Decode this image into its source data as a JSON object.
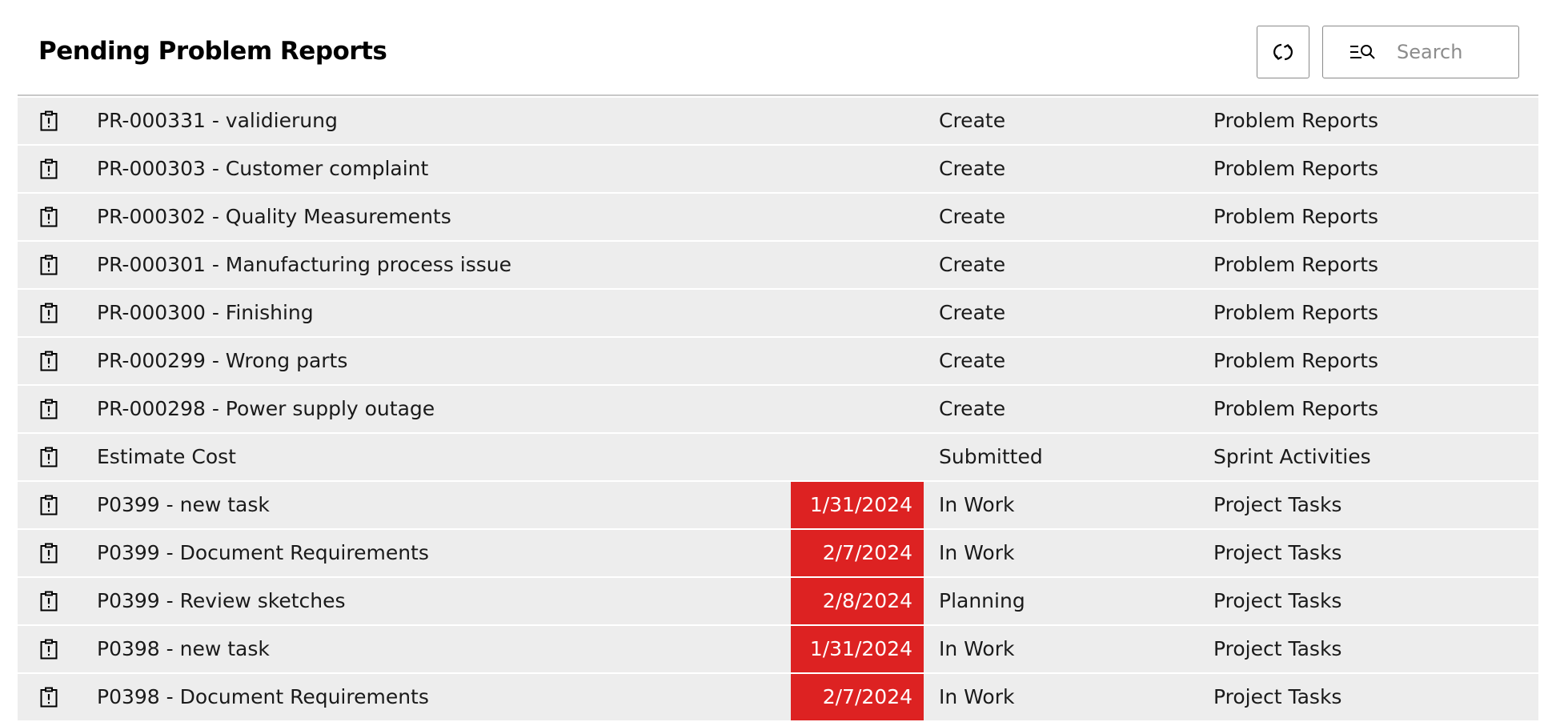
{
  "header": {
    "title": "Pending Problem Reports",
    "refresh_icon": "refresh-icon",
    "search": {
      "icon": "search-filter-icon",
      "placeholder": "Search",
      "value": ""
    }
  },
  "colors": {
    "row_background": "#ededed",
    "overdue": "#dd2222",
    "header_border": "#c8c8c8"
  },
  "rows": [
    {
      "icon": "clipboard-alert-icon",
      "title": "PR-000331 - validierung",
      "due_date": "",
      "status": "Create",
      "workspace": "Problem Reports"
    },
    {
      "icon": "clipboard-alert-icon",
      "title": "PR-000303 - Customer complaint",
      "due_date": "",
      "status": "Create",
      "workspace": "Problem Reports"
    },
    {
      "icon": "clipboard-alert-icon",
      "title": "PR-000302 - Quality Measurements",
      "due_date": "",
      "status": "Create",
      "workspace": "Problem Reports"
    },
    {
      "icon": "clipboard-alert-icon",
      "title": "PR-000301 - Manufacturing process issue",
      "due_date": "",
      "status": "Create",
      "workspace": "Problem Reports"
    },
    {
      "icon": "clipboard-alert-icon",
      "title": "PR-000300 - Finishing",
      "due_date": "",
      "status": "Create",
      "workspace": "Problem Reports"
    },
    {
      "icon": "clipboard-alert-icon",
      "title": "PR-000299 - Wrong parts",
      "due_date": "",
      "status": "Create",
      "workspace": "Problem Reports"
    },
    {
      "icon": "clipboard-alert-icon",
      "title": "PR-000298 - Power supply outage",
      "due_date": "",
      "status": "Create",
      "workspace": "Problem Reports"
    },
    {
      "icon": "clipboard-alert-icon",
      "title": "Estimate Cost",
      "due_date": "",
      "status": "Submitted",
      "workspace": "Sprint Activities"
    },
    {
      "icon": "clipboard-alert-icon",
      "title": "P0399 - new task",
      "due_date": "1/31/2024",
      "status": "In Work",
      "workspace": "Project Tasks"
    },
    {
      "icon": "clipboard-alert-icon",
      "title": "P0399 - Document Requirements",
      "due_date": "2/7/2024",
      "status": "In Work",
      "workspace": "Project Tasks"
    },
    {
      "icon": "clipboard-alert-icon",
      "title": "P0399 - Review sketches",
      "due_date": "2/8/2024",
      "status": "Planning",
      "workspace": "Project Tasks"
    },
    {
      "icon": "clipboard-alert-icon",
      "title": "P0398 - new task",
      "due_date": "1/31/2024",
      "status": "In Work",
      "workspace": "Project Tasks"
    },
    {
      "icon": "clipboard-alert-icon",
      "title": "P0398 - Document Requirements",
      "due_date": "2/7/2024",
      "status": "In Work",
      "workspace": "Project Tasks"
    }
  ]
}
